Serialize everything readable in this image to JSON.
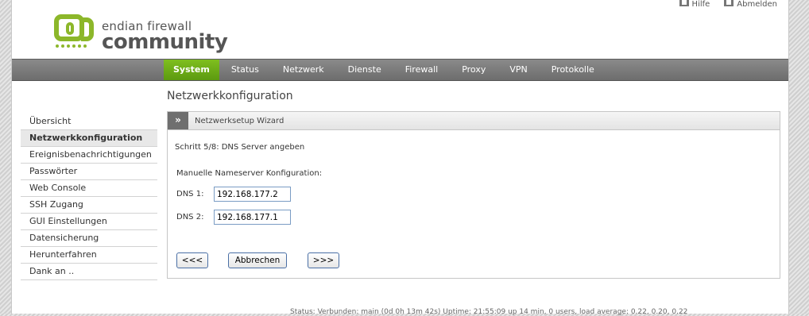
{
  "header": {
    "links": [
      {
        "label": "Hilfe",
        "icon": "help-icon"
      },
      {
        "label": "Abmelden",
        "icon": "logout-icon"
      }
    ],
    "logo": {
      "line1": "endian firewall",
      "line2": "community"
    }
  },
  "colors": {
    "accent": "#6aac16",
    "nav_bg": "#7a7a7a"
  },
  "nav": {
    "items": [
      {
        "label": "System",
        "active": true
      },
      {
        "label": "Status"
      },
      {
        "label": "Netzwerk"
      },
      {
        "label": "Dienste"
      },
      {
        "label": "Firewall"
      },
      {
        "label": "Proxy"
      },
      {
        "label": "VPN"
      },
      {
        "label": "Protokolle"
      }
    ]
  },
  "page": {
    "title": "Netzwerkkonfiguration"
  },
  "sidebar": {
    "items": [
      {
        "label": "Übersicht"
      },
      {
        "label": "Netzwerkkonfiguration",
        "active": true
      },
      {
        "label": "Ereignisbenachrichtigungen"
      },
      {
        "label": "Passwörter"
      },
      {
        "label": "Web Console"
      },
      {
        "label": "SSH Zugang"
      },
      {
        "label": "GUI Einstellungen"
      },
      {
        "label": "Datensicherung"
      },
      {
        "label": "Herunterfahren"
      },
      {
        "label": "Dank an .."
      }
    ]
  },
  "wizard": {
    "chevron": "»",
    "title": "Netzwerksetup Wizard",
    "step": "Schritt 5/8: DNS Server angeben",
    "section": "Manuelle Nameserver Konfiguration:",
    "dns1_label": "DNS 1:",
    "dns1_value": "192.168.177.2",
    "dns2_label": "DNS 2:",
    "dns2_value": "192.168.177.1",
    "back_label": "<<<",
    "cancel_label": "Abbrechen",
    "next_label": ">>>"
  },
  "footer": {
    "status": "Status: Verbunden: main (0d 0h 13m 42s) Uptime: 21:55:09 up 14 min, 0 users, load average: 0.22, 0.20, 0.22"
  }
}
